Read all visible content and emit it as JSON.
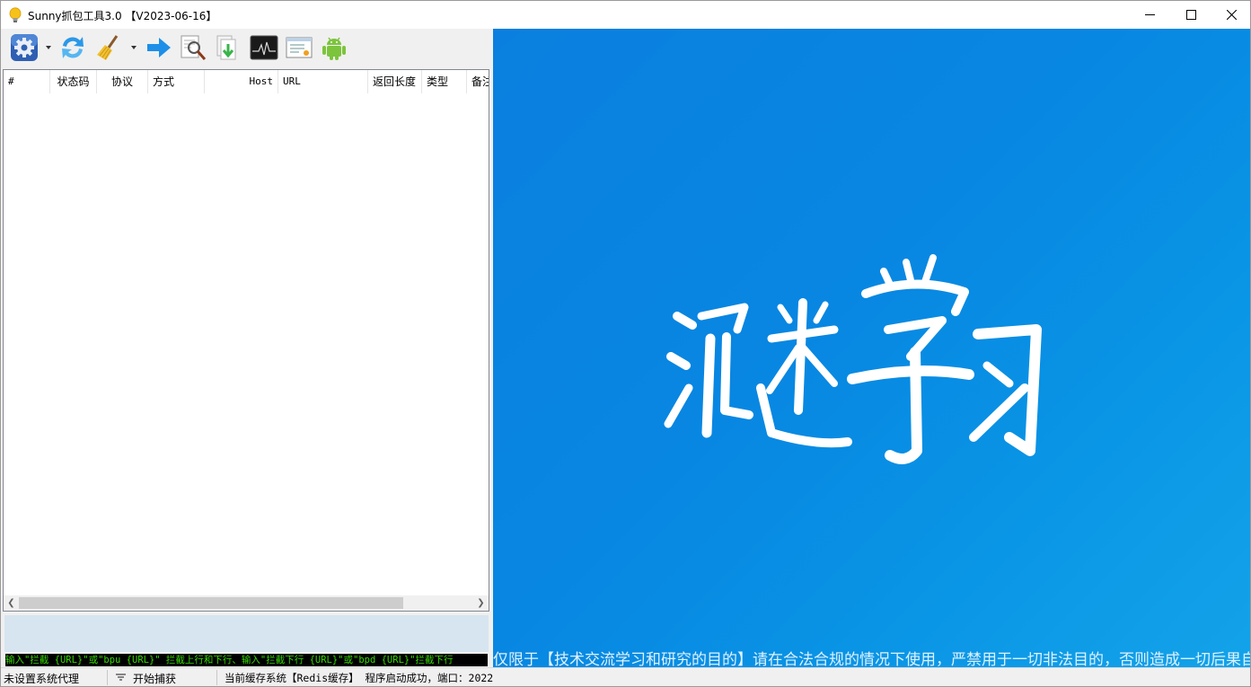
{
  "window": {
    "title": "Sunny抓包工具3.0 【V2023-06-16】",
    "controls": {
      "minimize": "minimize-icon",
      "maximize": "maximize-icon",
      "close": "close-icon"
    }
  },
  "toolbar": {
    "items": [
      {
        "name": "settings",
        "icon": "gear-icon",
        "has_dropdown": true
      },
      {
        "name": "refresh",
        "icon": "refresh-icon"
      },
      {
        "name": "clear",
        "icon": "broom-icon",
        "has_dropdown": true
      },
      {
        "name": "forward",
        "icon": "arrow-right-icon"
      },
      {
        "name": "search",
        "icon": "magnifier-icon"
      },
      {
        "name": "download",
        "icon": "download-icon"
      },
      {
        "name": "monitor",
        "icon": "monitor-icon"
      },
      {
        "name": "certificate",
        "icon": "certificate-icon"
      },
      {
        "name": "android",
        "icon": "android-icon"
      }
    ]
  },
  "table": {
    "columns": [
      "#",
      "状态码",
      "协议",
      "方式",
      "Host",
      "URL",
      "返回长度",
      "类型",
      "备注"
    ],
    "rows": []
  },
  "command_bar": {
    "text": "输入\"拦截 {URL}\"或\"bpu {URL}\" 拦截上行和下行、输入\"拦截下行 {URL}\"或\"bpd {URL}\"拦截下行"
  },
  "splash": {
    "calligraphy": "沉迷学习",
    "disclaimer": "仅限于【技术交流学习和研究的目的】请在合法合规的情况下使用，严禁用于一切非法目的，否则造成一切后果自负!"
  },
  "statusbar": {
    "proxy": "未设置系统代理",
    "capture": "开始捕获",
    "info": "当前缓存系统【Redis缓存】 程序启动成功，端口：2022"
  },
  "colors": {
    "splash_blue": "#0887e2",
    "cmd_text": "#36d900",
    "filter_panel": "#d6e5f0"
  }
}
